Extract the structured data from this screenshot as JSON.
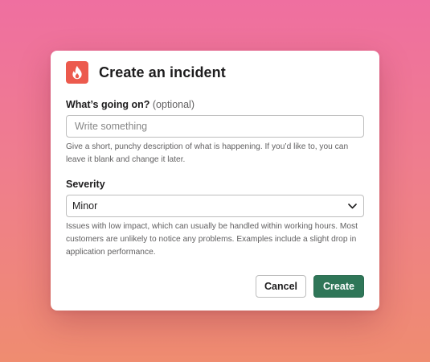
{
  "modal": {
    "title": "Create an incident",
    "app_icon": "flame-icon",
    "accent_color": "#ec5a4d"
  },
  "description_field": {
    "label": "What’s going on?",
    "optional_text": "(optional)",
    "placeholder": "Write something",
    "value": "",
    "hint": "Give a short, punchy description of what is happening. If you’d like to, you can leave it blank and change it later."
  },
  "severity_field": {
    "label": "Severity",
    "selected": "Minor",
    "hint": "Issues with low impact, which can usually be handled within working hours. Most customers are unlikely to notice any problems. Examples include a slight drop in application performance."
  },
  "actions": {
    "cancel_label": "Cancel",
    "create_label": "Create",
    "primary_color": "#2f7658"
  }
}
